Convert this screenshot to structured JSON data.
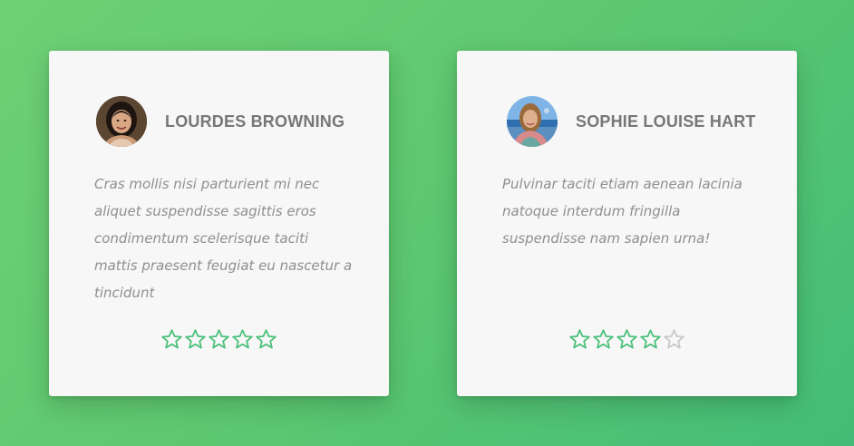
{
  "colors": {
    "background_start": "#6fd075",
    "background_end": "#43bd77",
    "card": "#f7f7f7",
    "name_text": "#777777",
    "quote_text": "#8f8f8f",
    "star_filled": "#4cc07a",
    "star_empty": "#c8c8c8"
  },
  "testimonials": [
    {
      "name": "LOURDES BROWNING",
      "avatar_icon": "woman-portrait-avatar",
      "quote": "Cras mollis nisi parturient mi nec aliquet suspendisse sagittis eros condimentum scelerisque taciti mattis praesent feugiat eu nascetur a tincidunt",
      "rating": 5,
      "rating_max": 5
    },
    {
      "name": "SOPHIE LOUISE HART",
      "avatar_icon": "woman-seaside-avatar",
      "quote": "Pulvinar taciti etiam aenean lacinia natoque interdum fringilla suspendisse nam sapien urna!",
      "rating": 4,
      "rating_max": 5
    }
  ]
}
